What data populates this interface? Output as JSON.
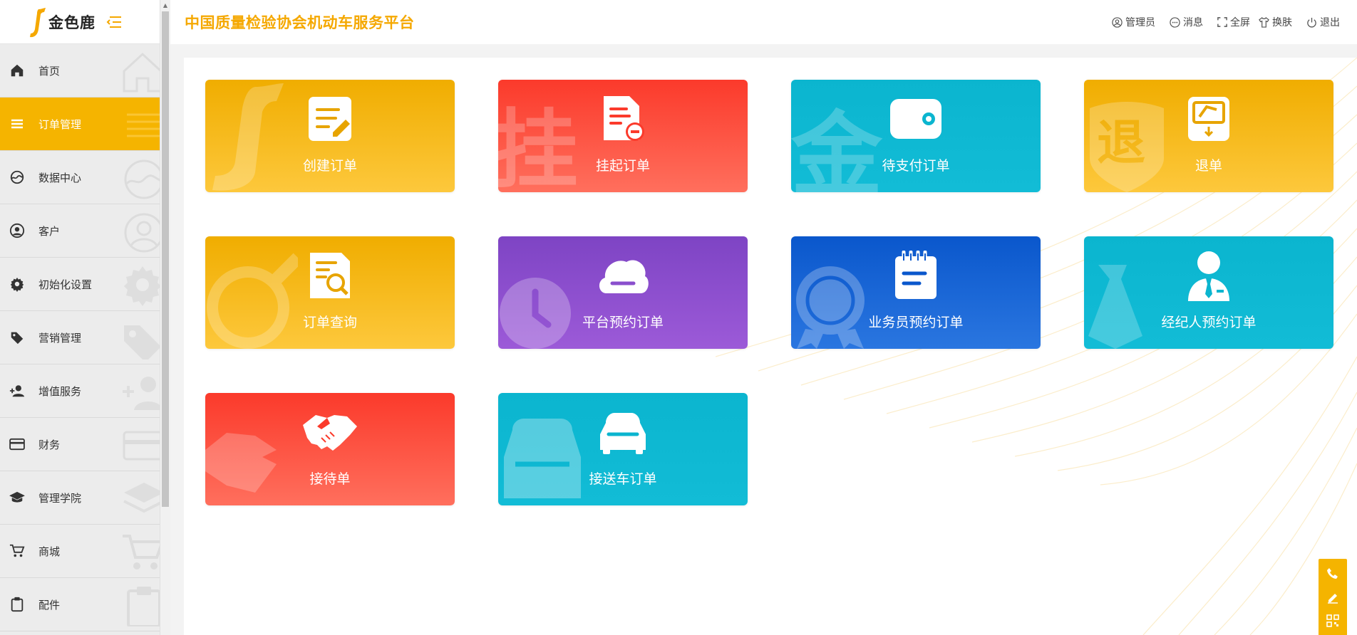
{
  "brand": {
    "logo_text": "金色鹿",
    "site_title": "中国质量检验协会机动车服务平台"
  },
  "header": {
    "actions": [
      {
        "label": "管理员",
        "icon": "user-circle-icon"
      },
      {
        "label": "消息",
        "icon": "message-icon"
      },
      {
        "label": "全屏",
        "icon": "fullscreen-icon"
      },
      {
        "label": "换肤",
        "icon": "shirt-icon"
      },
      {
        "label": "退出",
        "icon": "power-icon"
      }
    ]
  },
  "sidebar": {
    "items": [
      {
        "label": "首页",
        "icon": "home-icon",
        "active": false
      },
      {
        "label": "订单管理",
        "icon": "list-icon",
        "active": true
      },
      {
        "label": "数据中心",
        "icon": "chart-icon",
        "active": false
      },
      {
        "label": "客户",
        "icon": "user-icon",
        "active": false
      },
      {
        "label": "初始化设置",
        "icon": "gear-icon",
        "active": false
      },
      {
        "label": "营销管理",
        "icon": "tag-icon",
        "active": false
      },
      {
        "label": "增值服务",
        "icon": "add-user-icon",
        "active": false
      },
      {
        "label": "财务",
        "icon": "card-icon",
        "active": false
      },
      {
        "label": "管理学院",
        "icon": "graduation-icon",
        "active": false
      },
      {
        "label": "商城",
        "icon": "cart-icon",
        "active": false
      },
      {
        "label": "配件",
        "icon": "clipboard-icon",
        "active": false
      }
    ]
  },
  "cards": [
    {
      "label": "创建订单",
      "icon": "edit-document-icon",
      "color": "yellow"
    },
    {
      "label": "挂起订单",
      "icon": "suspend-document-icon",
      "color": "red"
    },
    {
      "label": "待支付订单",
      "icon": "wallet-icon",
      "color": "teal"
    },
    {
      "label": "退单",
      "icon": "refund-icon",
      "color": "yellow"
    },
    {
      "label": "订单查询",
      "icon": "search-document-icon",
      "color": "yellow"
    },
    {
      "label": "平台预约订单",
      "icon": "cloud-icon",
      "color": "purple"
    },
    {
      "label": "业务员预约订单",
      "icon": "notepad-icon",
      "color": "blue"
    },
    {
      "label": "经纪人预约订单",
      "icon": "agent-icon",
      "color": "teal"
    },
    {
      "label": "接待单",
      "icon": "handshake-icon",
      "color": "red"
    },
    {
      "label": "接送车订单",
      "icon": "car-icon",
      "color": "teal"
    }
  ],
  "colors": {
    "accent": "#f5b400",
    "title": "#f5a800",
    "red": "#fb3a2b",
    "teal": "#0bb5cf",
    "purple": "#8a4fcd",
    "blue": "#0a57cc"
  },
  "float_tools": [
    "phone-icon",
    "pen-icon",
    "qrcode-icon"
  ]
}
